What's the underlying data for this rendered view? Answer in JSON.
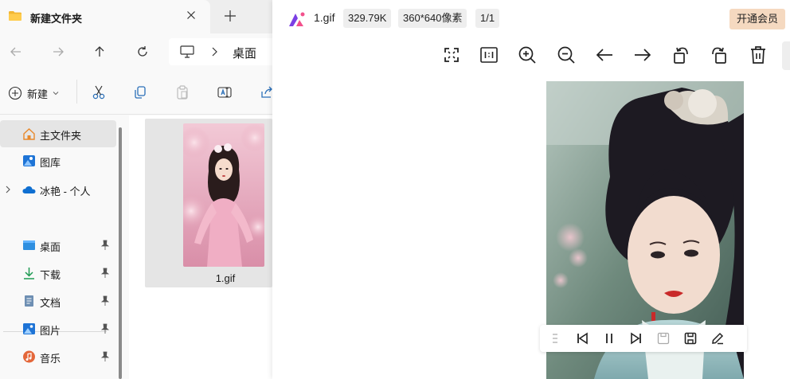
{
  "explorer": {
    "tab_title": "新建文件夹",
    "tab_icons": {
      "folder": "folder-icon",
      "close": "close-icon",
      "new_tab": "plus-icon"
    },
    "nav_icons": [
      "back-arrow-icon",
      "forward-arrow-icon",
      "up-arrow-icon",
      "refresh-icon"
    ],
    "address": {
      "root_icon": "computer-icon",
      "separator_icon": "chevron-right-icon",
      "location": "桌面"
    },
    "commands": {
      "new_label": "新建",
      "icons": [
        "plus-circle-icon",
        "chevron-down-icon",
        "cut-icon",
        "copy-icon",
        "paste-icon",
        "rename-icon",
        "share-icon"
      ]
    },
    "sidebar": {
      "items": [
        {
          "label": "主文件夹",
          "icon": "home-icon",
          "selected": true
        },
        {
          "label": "图库",
          "icon": "gallery-icon"
        },
        {
          "label": "冰艳 - 个人",
          "icon": "cloud-icon"
        }
      ],
      "quick_access": [
        {
          "label": "桌面",
          "icon": "desktop-icon",
          "pinned": true
        },
        {
          "label": "下载",
          "icon": "download-icon",
          "pinned": true
        },
        {
          "label": "文档",
          "icon": "document-icon",
          "pinned": true
        },
        {
          "label": "图片",
          "icon": "picture-icon",
          "pinned": true
        },
        {
          "label": "音乐",
          "icon": "music-icon",
          "pinned": true
        }
      ]
    },
    "files": [
      {
        "name": "1.gif",
        "thumbnail": "portrait-thumbnail"
      }
    ]
  },
  "viewer": {
    "file_name": "1.gif",
    "file_size": "329.79K",
    "dimensions": "360*640像素",
    "page_index": "1/1",
    "vip_button": "开通会员",
    "toolbar_icons": [
      "fullscreen-icon",
      "actual-size-icon",
      "zoom-in-icon",
      "zoom-out-icon",
      "previous-icon",
      "next-icon",
      "rotate-left-icon",
      "rotate-right-icon",
      "delete-icon"
    ],
    "playback_icons": [
      "drag-handle-icon",
      "skip-back-icon",
      "pause-icon",
      "skip-forward-icon",
      "save-frame-icon",
      "save-icon",
      "edit-icon"
    ],
    "colors": {
      "vip_bg": "#f5d9c0",
      "chip_bg": "#eeeeee",
      "logo_purple": "#7b3fe4",
      "logo_pink": "#f2508c"
    }
  }
}
